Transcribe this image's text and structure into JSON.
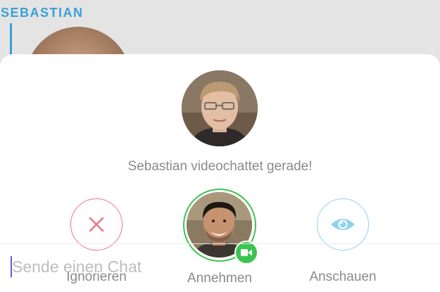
{
  "background": {
    "contact_name": "SEBASTIAN"
  },
  "sheet": {
    "caller_avatar": "avatar-photo",
    "headline": "Sebastian videochattet gerade!",
    "actions": {
      "ignore": {
        "label": "Ignorieren",
        "icon": "close-icon",
        "color": "#ea7983"
      },
      "accept": {
        "label": "Annehmen",
        "icon": "video-camera-icon",
        "color": "#3cc450"
      },
      "watch": {
        "label": "Anschauen",
        "icon": "eye-icon",
        "color": "#8fd2ef"
      }
    },
    "chat": {
      "placeholder": "Sende einen Chat",
      "value": ""
    }
  },
  "colors": {
    "accent_blue": "#3aa0d8",
    "ignore_red": "#ea7983",
    "accept_green": "#3cc450",
    "watch_blue": "#8fd2ef"
  }
}
